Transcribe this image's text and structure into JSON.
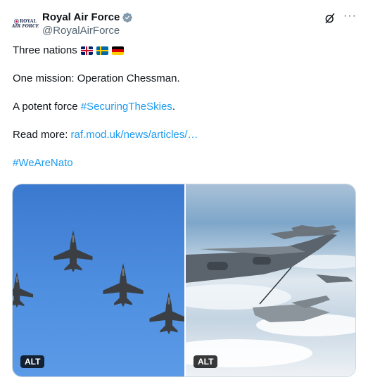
{
  "account": {
    "display_name": "Royal Air Force",
    "handle": "@RoyalAirForce",
    "avatar_text_top": "ROYAL",
    "avatar_text_bottom": "AIR FORCE",
    "verified_color": "#829aab"
  },
  "post": {
    "line1_text": "Three nations",
    "line1_flags": [
      "flag-uk",
      "flag-se",
      "flag-de"
    ],
    "line2_text": "One mission: Operation Chessman.",
    "line3_prefix": "A potent force ",
    "line3_hashtag": "#SecuringTheSkies",
    "line3_suffix": ".",
    "line4_prefix": "Read more: ",
    "line4_link": "raf.mod.uk/news/articles/…",
    "line5_hashtag": "#WeAreNato"
  },
  "media": {
    "left_alt": "ALT",
    "right_alt": "ALT"
  },
  "icons": [
    "grok-icon",
    "more-icon",
    "verified-badge-icon"
  ],
  "colors": {
    "link": "#1d9bf0",
    "text": "#0f1419",
    "secondary": "#536471"
  }
}
